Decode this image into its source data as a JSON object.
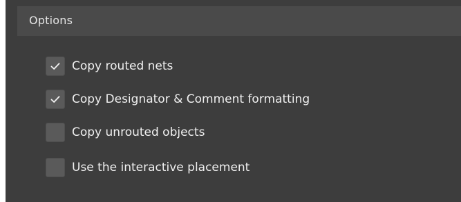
{
  "section": {
    "title": "Options"
  },
  "options": [
    {
      "label": "Copy routed nets",
      "checked": true
    },
    {
      "label": "Copy Designator & Comment formatting",
      "checked": true
    },
    {
      "label": "Copy unrouted objects",
      "checked": false
    },
    {
      "label": "Use the interactive placement",
      "checked": false
    }
  ],
  "colors": {
    "panel_background": "#3d3d3d",
    "header_background": "#4a4a4a",
    "checkbox_fill": "#5a5a5a",
    "text": "#f0f0f0"
  }
}
